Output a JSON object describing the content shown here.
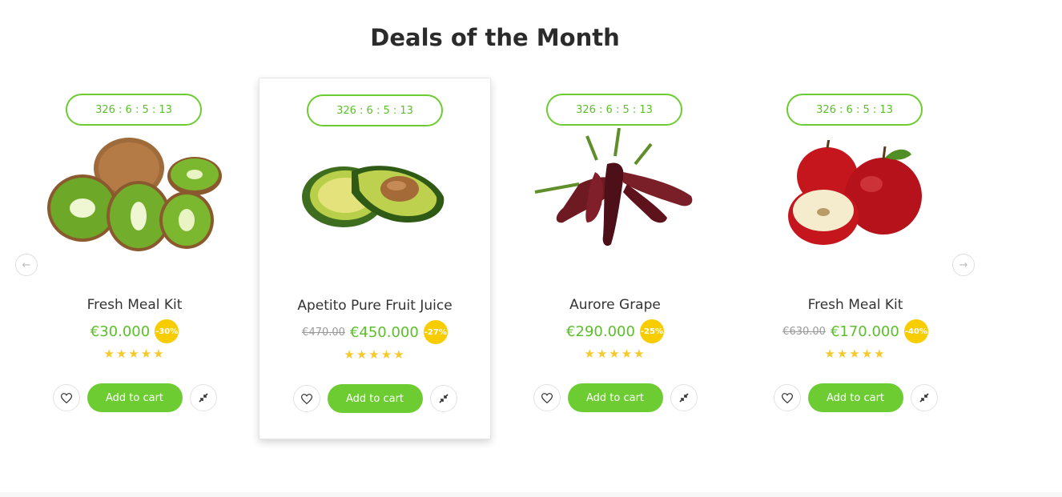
{
  "section": {
    "title": "Deals of the Month"
  },
  "nav": {
    "prev_icon": "arrow-left-icon",
    "next_icon": "arrow-right-icon"
  },
  "colors": {
    "accent": "#6ccc32",
    "price": "#5bbf2a",
    "badge": "#f8cd00",
    "stars": "#f6c92b"
  },
  "products": [
    {
      "timer": "326 : 6 : 5 : 13",
      "image": "kiwi-image",
      "name": "Fresh Meal Kit",
      "old_price": "",
      "price": "€30.000",
      "discount": "-30%",
      "rating": 5,
      "stars": "★★★★★",
      "cart_label": "Add to cart"
    },
    {
      "timer": "326 : 6 : 5 : 13",
      "image": "avocado-image",
      "name": "Apetito Pure Fruit Juice",
      "old_price": "€470.00",
      "price": "€450.000",
      "discount": "-27%",
      "rating": 5,
      "stars": "★★★★★",
      "cart_label": "Add to cart"
    },
    {
      "timer": "326 : 6 : 5 : 13",
      "image": "peppers-image",
      "name": "Aurore Grape",
      "old_price": "",
      "price": "€290.000",
      "discount": "-25%",
      "rating": 5,
      "stars": "★★★★★",
      "cart_label": "Add to cart"
    },
    {
      "timer": "326 : 6 : 5 : 13",
      "image": "apples-image",
      "name": "Fresh Meal Kit",
      "old_price": "€630.00",
      "price": "€170.000",
      "discount": "-40%",
      "rating": 5,
      "stars": "★★★★★",
      "cart_label": "Add to cart"
    }
  ]
}
